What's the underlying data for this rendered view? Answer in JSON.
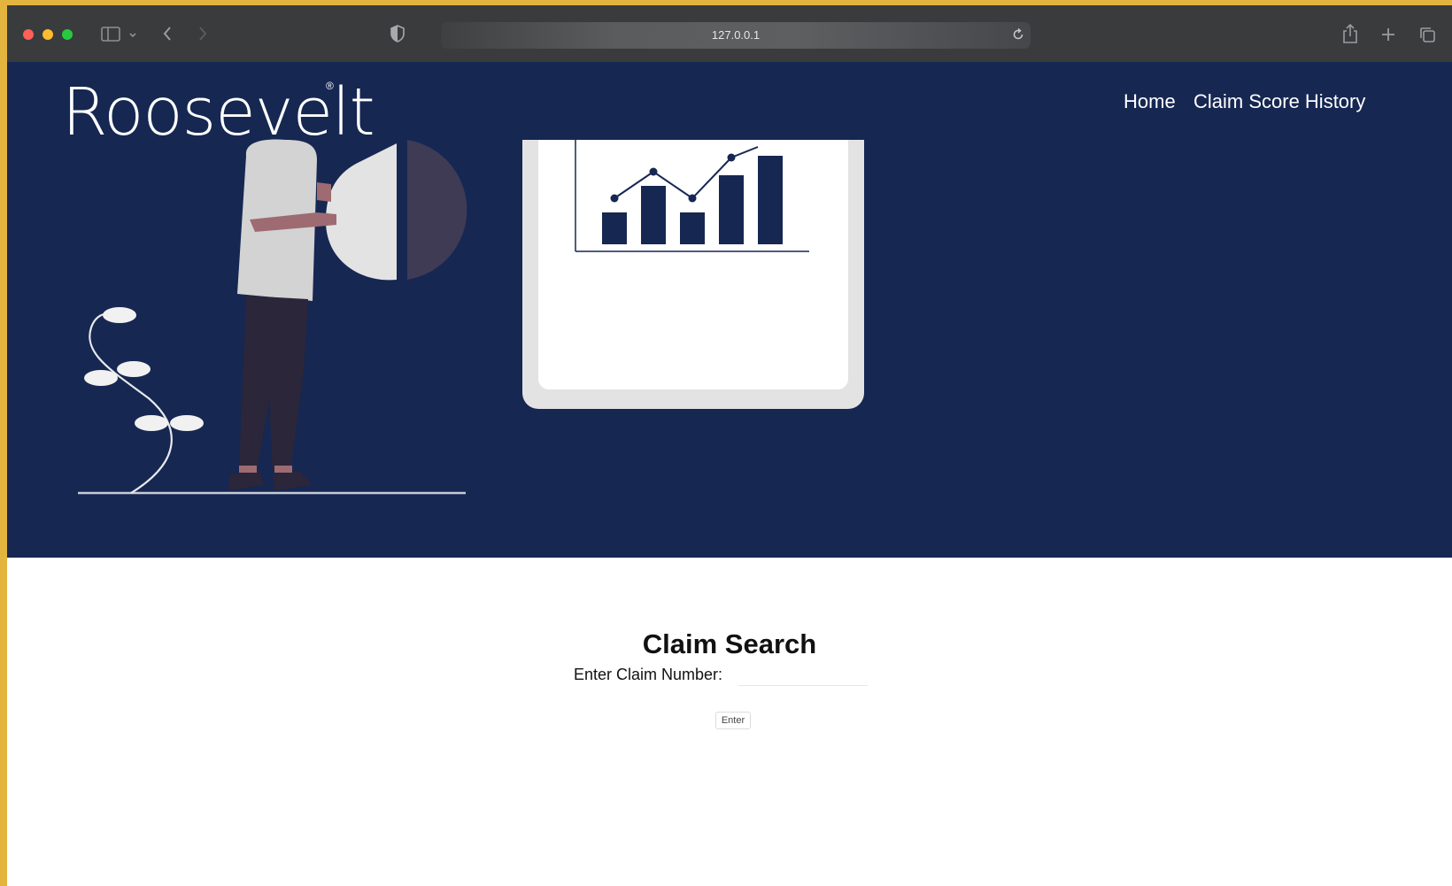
{
  "browser": {
    "url": "127.0.0.1",
    "traffic_lights": [
      "#fe5f57",
      "#febc2e",
      "#28c840"
    ]
  },
  "header": {
    "logo_text": "Roosevelt",
    "logo_mark": "®",
    "nav": [
      {
        "label": "Home"
      },
      {
        "label": "Claim Score History"
      }
    ]
  },
  "main": {
    "title": "Claim Search",
    "claim_label": "Enter Claim Number:",
    "claim_value": "",
    "enter_label": "Enter"
  },
  "colors": {
    "hero_bg": "#162752",
    "accent_dark": "#162752",
    "figure_shirt": "#d3d3d3",
    "figure_pants": "#2b2639",
    "skin": "#9d6b71",
    "pie_dark": "#3f3b55"
  },
  "icons": [
    "sidebar-icon",
    "chevron-down-icon",
    "back-arrow-icon",
    "forward-arrow-icon",
    "shield-icon",
    "reload-icon",
    "share-icon",
    "new-tab-icon",
    "tabs-overview-icon"
  ]
}
